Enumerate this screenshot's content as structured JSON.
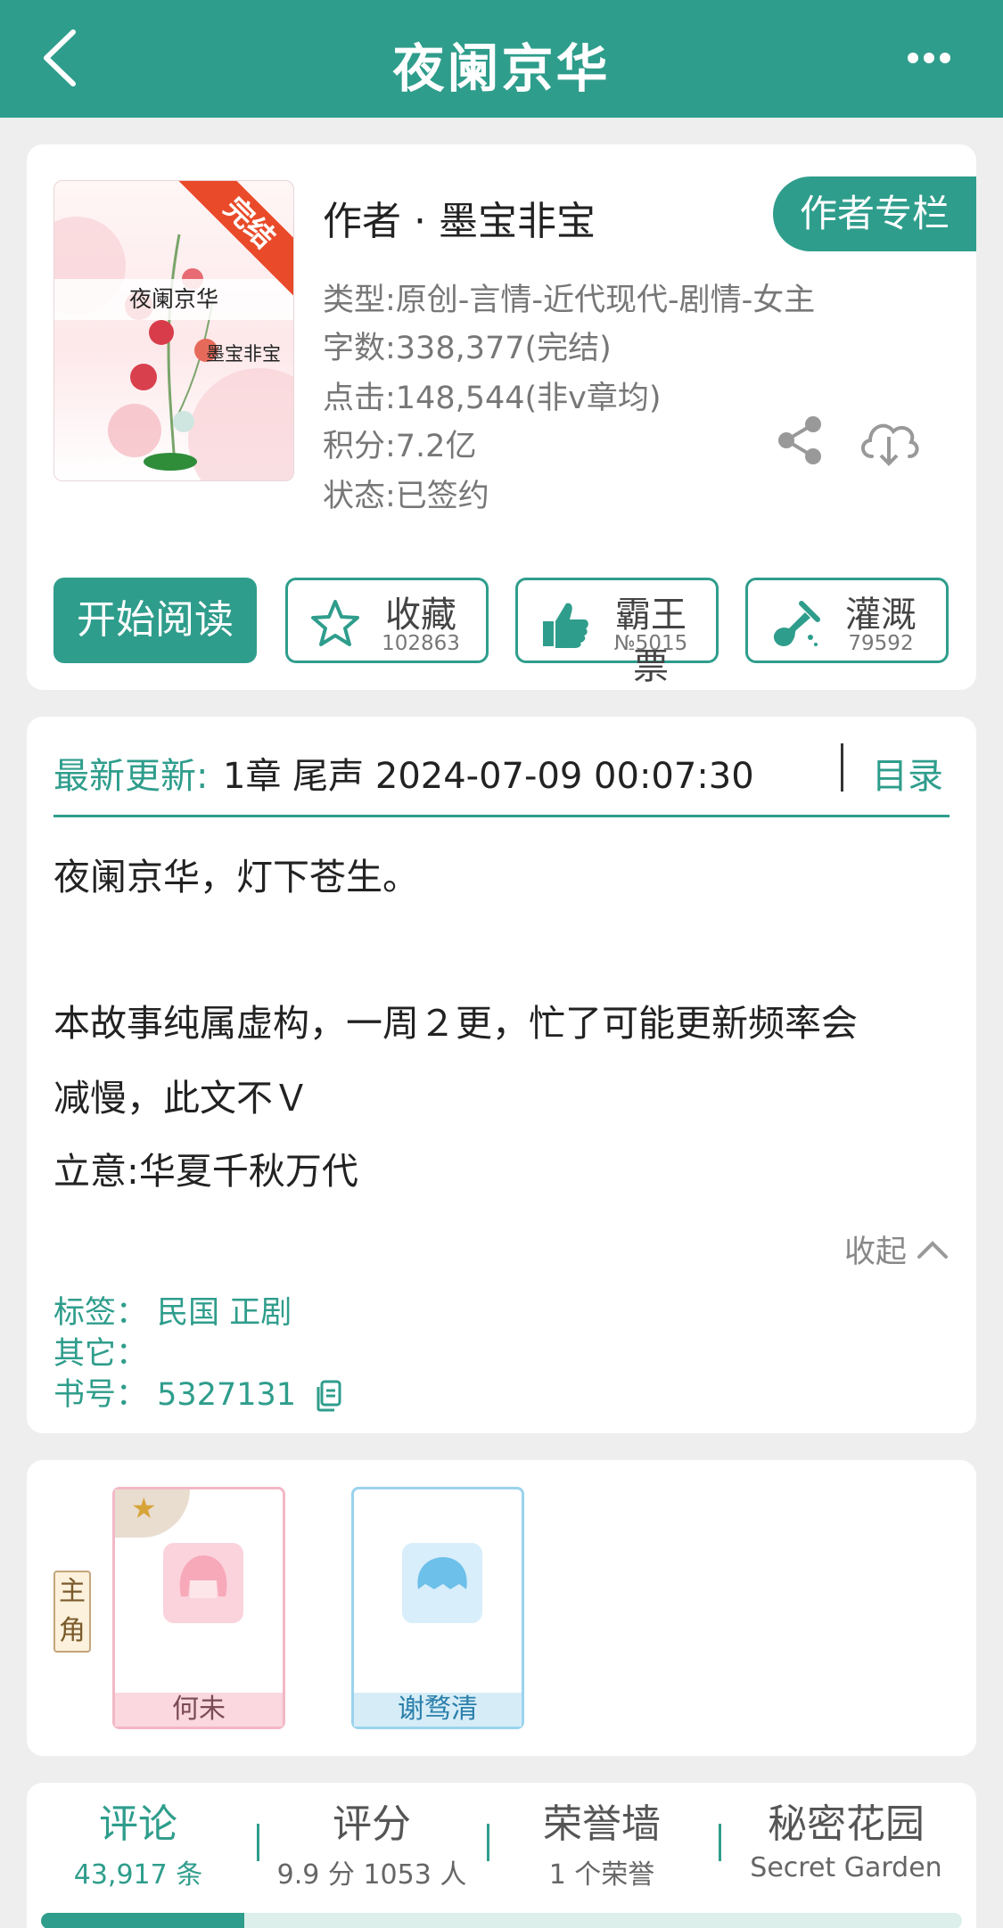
{
  "header": {
    "title": "夜阑京华",
    "back_icon": "chevron-left-icon",
    "more_icon": "more-dots-icon"
  },
  "book": {
    "cover": {
      "title": "夜阑京华",
      "author": "墨宝非宝",
      "ribbon": "完结"
    },
    "author_line": "作者 · 墨宝非宝",
    "author_column_button": "作者专栏",
    "meta": [
      "类型:原创-言情-近代现代-剧情-女主",
      "字数:338,377(完结)",
      "点击:148,544(非v章均)",
      "积分:7.2亿",
      "状态:已签约"
    ]
  },
  "actions": {
    "read": "开始阅读",
    "collect": {
      "label": "收藏",
      "count": "102863"
    },
    "vote": {
      "label": "霸王票",
      "count": "№5015"
    },
    "water": {
      "label": "灌溉",
      "count": "79592"
    }
  },
  "update": {
    "label": "最新更新:",
    "value": "1章 尾声 2024-07-09 00:07:30",
    "toc": "目录"
  },
  "intro": {
    "line1": "夜阑京华，灯下苍生。",
    "line2": "本故事纯属虚构，一周２更，忙了可能更新频率会",
    "line3": "减慢，此文不Ｖ",
    "line4": "立意:华夏千秋万代",
    "collapse": "收起"
  },
  "tags": {
    "tags_label": "标签：",
    "tags_value": "民国  正剧",
    "other_label": "其它：",
    "id_label": "书号：",
    "id_value": "5327131"
  },
  "characters": {
    "lead_badge": "主角",
    "roles": [
      {
        "name": "何未"
      },
      {
        "name": "谢骛清"
      }
    ]
  },
  "tabs": [
    {
      "title": "评论",
      "sub": "43,917 条"
    },
    {
      "title": "评分",
      "sub": "9.9 分 1053 人"
    },
    {
      "title": "荣誉墙",
      "sub": "1 个荣誉"
    },
    {
      "title": "秘密花园",
      "sub": "Secret Garden"
    }
  ],
  "colors": {
    "accent": "#2f9d8c",
    "ribbon": "#e94b2a"
  }
}
